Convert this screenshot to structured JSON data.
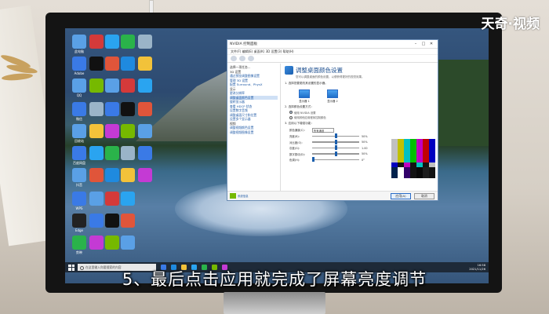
{
  "watermark": "天奇·视频",
  "caption": "5、最后点击应用就完成了屏幕亮度调节",
  "window": {
    "title": "NVIDIA 控制面板",
    "menu": "文件(F)  编辑(E)  桌面(K)  3D 设置(3)  帮助(H)",
    "tree": [
      {
        "label": "选择一项任务...",
        "type": "head"
      },
      {
        "label": "3D 设置",
        "type": "head"
      },
      {
        "label": "通过预览调整图像设置",
        "type": "item"
      },
      {
        "label": "管理 3D 设置",
        "type": "item"
      },
      {
        "label": "配置 Surround、PhysX",
        "type": "item"
      },
      {
        "label": "显示",
        "type": "head"
      },
      {
        "label": "更改分辨率",
        "type": "item"
      },
      {
        "label": "调整桌面颜色设置",
        "type": "sel"
      },
      {
        "label": "旋转显示器",
        "type": "item"
      },
      {
        "label": "查看 HDCP 状态",
        "type": "item"
      },
      {
        "label": "设置数字音频",
        "type": "item"
      },
      {
        "label": "调整桌面尺寸和位置",
        "type": "item"
      },
      {
        "label": "设置多个显示器",
        "type": "item"
      },
      {
        "label": "视频",
        "type": "head"
      },
      {
        "label": "调整视频颜色设置",
        "type": "item"
      },
      {
        "label": "调整视频图像设置",
        "type": "item"
      }
    ],
    "heading": "调整桌面颜色设置",
    "subheading": "您可以调整桌面的颜色设置，以便获得更好的视觉效果。",
    "section1": "1. 选择您要更改其设置的显示器。",
    "displays": [
      "显示器 1",
      "显示器 2"
    ],
    "section2": "2. 选择颜色设置方式：",
    "radio_options": [
      "使用 NVIDIA 设置",
      "使用其他应用程序控制颜色"
    ],
    "section3": "3. 应用以下增强功能：",
    "channel_label": "颜色通道(C):",
    "channel_value": "所有通道",
    "sliders": [
      {
        "label": "亮度(B):",
        "value": 50,
        "text": "50%"
      },
      {
        "label": "对比度(O):",
        "value": 50,
        "text": "50%"
      },
      {
        "label": "灰度(G):",
        "value": 50,
        "text": "1.00"
      },
      {
        "label": "数字振动(D):",
        "value": 50,
        "text": "50%"
      },
      {
        "label": "色调(H):",
        "value": 0,
        "text": "0°"
      }
    ],
    "footer_link": "系统信息",
    "apply": "应用(A)",
    "cancel": "取消"
  },
  "desktop_icons": [
    {
      "label": "此电脑",
      "color": "#5aa0e6"
    },
    {
      "label": "Adobe",
      "color": "#d43a3a"
    },
    {
      "label": "QQ",
      "color": "#2aa4f0"
    },
    {
      "label": "微信",
      "color": "#2ab34a"
    },
    {
      "label": "回收站",
      "color": "#9ab4c8"
    },
    {
      "label": "百度网盘",
      "color": "#3a7ae6"
    },
    {
      "label": "抖音",
      "color": "#111111"
    },
    {
      "label": "WPS",
      "color": "#e0553a"
    },
    {
      "label": "Edge",
      "color": "#1f8adf"
    },
    {
      "label": "剪映",
      "color": "#222222"
    }
  ],
  "taskbar": {
    "search_placeholder": "在这里输入你要搜索的内容",
    "time": "16:58",
    "date": "2021/11/26"
  }
}
